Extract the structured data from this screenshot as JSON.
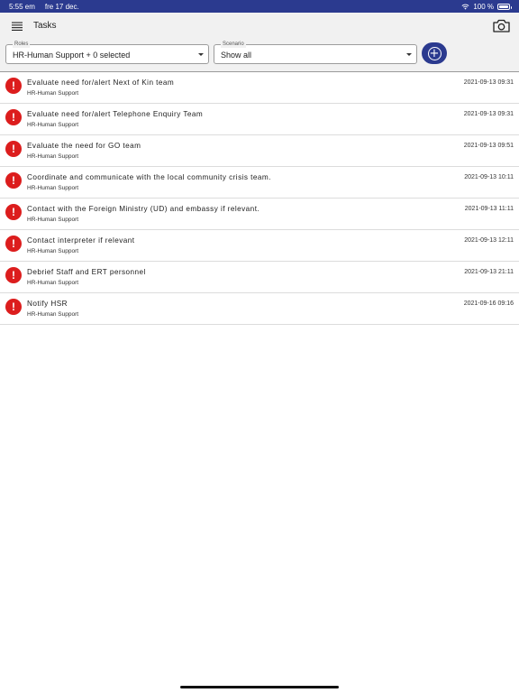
{
  "status_bar": {
    "time": "5:55 em",
    "date": "fre 17 dec.",
    "battery_text": "100 %",
    "icons": [
      "wifi-icon",
      "battery-icon"
    ]
  },
  "app_bar": {
    "title": "Tasks",
    "icons": [
      "menu-icon",
      "camera-icon"
    ]
  },
  "filters": {
    "roles": {
      "label": "Roles",
      "value": "HR-Human Support + 0 selected"
    },
    "scenario": {
      "label": "Scenario",
      "value": "Show all"
    },
    "add_icon": "add-circle-icon"
  },
  "colors": {
    "accent": "#2b3a8f",
    "alert": "#dc1d1d",
    "toolbar_bg": "#f1f1f1"
  },
  "tasks": [
    {
      "title": "Evaluate need for/alert Next of Kin team",
      "role": "HR-Human Support",
      "date": "2021-09-13 09:31",
      "icon": "alert-icon"
    },
    {
      "title": "Evaluate need for/alert Telephone Enquiry Team",
      "role": "HR-Human Support",
      "date": "2021-09-13 09:31",
      "icon": "alert-icon"
    },
    {
      "title": "Evaluate the need for GO team",
      "role": "HR-Human Support",
      "date": "2021-09-13 09:51",
      "icon": "alert-icon"
    },
    {
      "title": "Coordinate and communicate with the local community crisis team.",
      "role": "HR-Human Support",
      "date": "2021-09-13 10:11",
      "icon": "alert-icon"
    },
    {
      "title": "Contact with the Foreign Ministry (UD) and embassy if relevant.",
      "role": "HR-Human Support",
      "date": "2021-09-13 11:11",
      "icon": "alert-icon"
    },
    {
      "title": "Contact interpreter if relevant",
      "role": "HR-Human Support",
      "date": "2021-09-13 12:11",
      "icon": "alert-icon"
    },
    {
      "title": "Debrief Staff and ERT personnel",
      "role": "HR-Human Support",
      "date": "2021-09-13 21:11",
      "icon": "alert-icon"
    },
    {
      "title": "Notify HSR",
      "role": "HR-Human Support",
      "date": "2021-09-16 09:16",
      "icon": "alert-icon"
    }
  ]
}
